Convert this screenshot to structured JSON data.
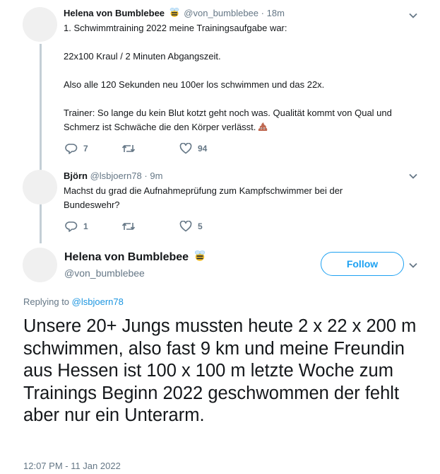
{
  "tweet1": {
    "name": "Helena von Bumblebee",
    "handle": "@von_bumblebee",
    "dot": "·",
    "time": "18m",
    "lines": [
      "1. Schwimmtraining 2022 meine Trainingsaufgabe war:",
      "22x100 Kraul / 2 Minuten Abgangszeit.",
      "Also alle 120 Sekunden neu 100er los schwimmen und das 22x.",
      "Trainer: So lange du kein Blut kotzt geht noch was. Qualität kommt von Qual und Schmerz ist Schwäche die den Körper verlässt."
    ],
    "replies": "7",
    "retweets": "",
    "likes": "94"
  },
  "tweet2": {
    "name": "Björn",
    "handle": "@lsbjoern78",
    "dot": "·",
    "time": "9m",
    "text": "Machst du grad die Aufnahmeprüfung zum Kampfschwimmer bei der Bundeswehr?",
    "replies": "1",
    "retweets": "",
    "likes": "5"
  },
  "main": {
    "name": "Helena von Bumblebee",
    "handle": "@von_bumblebee",
    "follow_label": "Follow",
    "replying_prefix": "Replying to",
    "replying_handle": "@lsbjoern78",
    "text": "Unsere 20+ Jungs mussten heute 2 x 22 x 200 m schwimmen, also fast 9 km und meine Freundin aus Hessen ist 100 x 100 m letzte Woche zum Trainings Beginn 2022 geschwommen der fehlt aber nur ein Unterarm.",
    "timestamp": "12:07 PM - 11 Jan 2022"
  },
  "colors": {
    "accent": "#1da1f2",
    "secondary_text": "#657786",
    "thread_line": "#c4cfd6"
  },
  "icons": [
    "bee-emoji-icon",
    "poop-emoji-icon",
    "reply-icon",
    "retweet-icon",
    "like-icon",
    "chevron-down-icon"
  ]
}
